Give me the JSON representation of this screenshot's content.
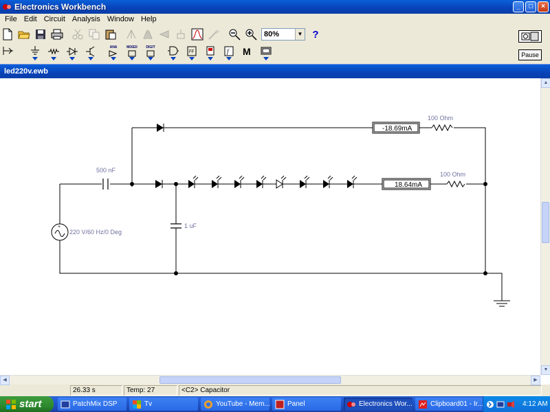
{
  "window": {
    "title": "Electronics Workbench",
    "min": "_",
    "max": "□",
    "close": "×"
  },
  "menu": [
    "File",
    "Edit",
    "Circuit",
    "Analysis",
    "Window",
    "Help"
  ],
  "toolbar": {
    "zoom": "80%",
    "help": "?",
    "pause": "Pause",
    "power_label": "I"
  },
  "component_bins": [
    "ANA",
    "MIXED",
    "DIGIT"
  ],
  "document": {
    "title": "led220v.ewb"
  },
  "circuit": {
    "cap1": "500 nF",
    "cap2": "1 uF",
    "source": "220 V/60 Hz/0 Deg",
    "res_top": "100  Ohm",
    "res_mid": "100  Ohm",
    "ammeter_top": "-18.69mA",
    "ammeter_mid": "18.64mA"
  },
  "status": {
    "time": "26.33 s",
    "temp": "Temp:  27",
    "selection": "<C2> Capacitor"
  },
  "taskbar": {
    "start": "start",
    "tasks": [
      {
        "label": "PatchMix DSP"
      },
      {
        "label": "Tv"
      },
      {
        "label": "YouTube - Mem..."
      },
      {
        "label": "Panel"
      },
      {
        "label": "Electronics Wor..."
      },
      {
        "label": "Clipboard01 - Ir..."
      }
    ],
    "clock": "4:12 AM"
  },
  "colors": {
    "wire": "#000000",
    "label": "#7070a0",
    "titlebar": "#0a5fd8",
    "taskbar": "#245edb",
    "start": "#2f8a2f"
  }
}
